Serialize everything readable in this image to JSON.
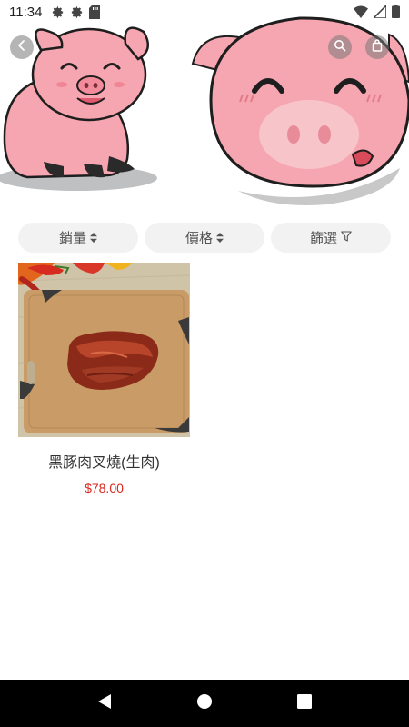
{
  "status_bar": {
    "time": "11:34",
    "icons_left": [
      "gear-icon",
      "gear-icon",
      "sd-card-icon"
    ],
    "icons_right": [
      "wifi-icon",
      "signal-icon",
      "battery-icon"
    ]
  },
  "header": {
    "back_icon": "chevron-left-icon",
    "search_icon": "search-icon",
    "cart_icon": "shopping-bag-icon"
  },
  "sort_bar": {
    "sales_label": "銷量",
    "price_label": "價格",
    "filter_label": "篩選"
  },
  "products": [
    {
      "name": "黑豚肉叉燒(生肉)",
      "price": "$78.00"
    }
  ],
  "colors": {
    "price": "#d9251c",
    "pig_pink": "#f6a8b1",
    "pill_bg": "#f2f2f2",
    "nav_bg": "#000000"
  }
}
